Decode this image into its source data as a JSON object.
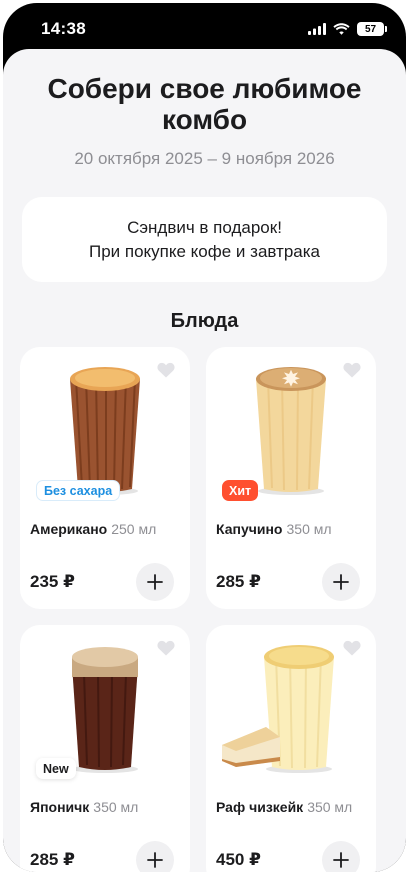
{
  "status_bar": {
    "time": "14:38",
    "battery": "57"
  },
  "header": {
    "title": "Собери свое любимое комбо",
    "dates": "20 октября 2025 – 9 ноября 2026"
  },
  "promo": {
    "line1": "Сэндвич в подарок!",
    "line2": "При покупке кофе и завтрака"
  },
  "section_title": "Блюда",
  "products": [
    {
      "name": "Американо",
      "volume": "250 мл",
      "price": "235 ₽",
      "badge": "Без сахара"
    },
    {
      "name": "Капучино",
      "volume": "350 мл",
      "price": "285 ₽",
      "badge": "Хит"
    },
    {
      "name": "Японичк",
      "volume": "350 мл",
      "price": "285 ₽",
      "badge": "New"
    },
    {
      "name": "Раф чизкейк",
      "volume": "350 мл",
      "price": "450 ₽",
      "badge": ""
    }
  ],
  "colors": {
    "accent_hit": "#ff4f2f",
    "accent_sugar": "#1d8fe0",
    "background": "#f5f5f7"
  },
  "icons": {
    "favorite": "heart-icon",
    "add": "plus-icon",
    "signal": "signal-icon",
    "wifi": "wifi-icon",
    "battery": "battery-icon"
  }
}
